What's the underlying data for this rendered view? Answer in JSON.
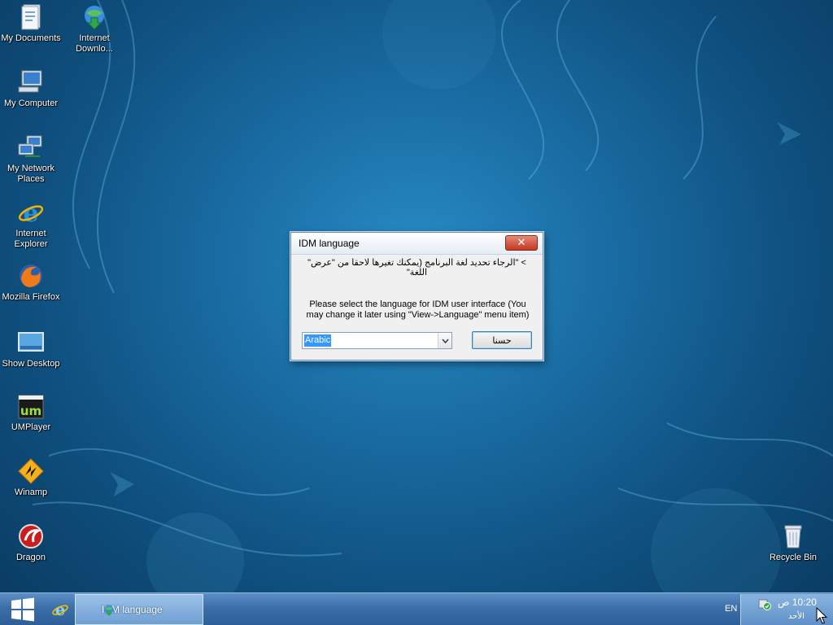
{
  "desktop": {
    "icons": [
      {
        "label": "My Documents",
        "icon": "my-documents-icon"
      },
      {
        "label": "Internet Downlo...",
        "icon": "internet-download-manager-icon"
      },
      {
        "label": "My Computer",
        "icon": "my-computer-icon"
      },
      {
        "label": "My Network Places",
        "icon": "network-places-icon"
      },
      {
        "label": "Internet Explorer",
        "icon": "internet-explorer-icon"
      },
      {
        "label": "Mozilla Firefox",
        "icon": "firefox-icon"
      },
      {
        "label": "Show Desktop",
        "icon": "show-desktop-icon"
      },
      {
        "label": "UMPlayer",
        "icon": "umplayer-icon"
      },
      {
        "label": "Winamp",
        "icon": "winamp-icon"
      },
      {
        "label": "Dragon",
        "icon": "dragon-icon"
      },
      {
        "label": "Recycle Bin",
        "icon": "recycle-bin-icon"
      }
    ]
  },
  "dialog": {
    "title": "IDM language",
    "close_glyph": "✕",
    "arabic_message": "> \"الرجاء تحديد لغة البرنامج (يمكنك تغيرها لاحقا من \"عرض\" اللغة\"",
    "english_message": "Please select the language for IDM user interface (You may change it later using \"View->Language\" menu item)",
    "selected_language": "Arabic",
    "ok_label": "حسنا"
  },
  "taskbar": {
    "task_label": "IDM language",
    "language": "EN",
    "time": "10:20 ص",
    "day": "الأحد"
  },
  "colors": {
    "wallpaper": "#1a6fa6",
    "taskbar": "#3c6fa8",
    "selection": "#3399ff",
    "close_button": "#c4391f"
  }
}
